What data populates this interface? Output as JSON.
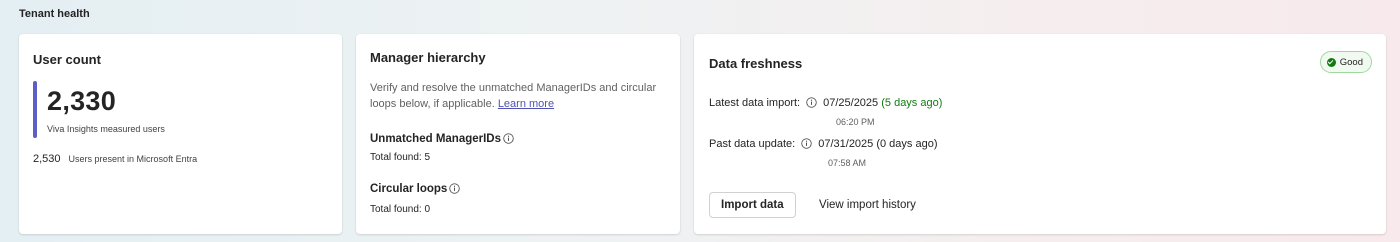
{
  "page": {
    "title": "Tenant health"
  },
  "user_count": {
    "title": "User count",
    "measured_value": "2,330",
    "measured_label": "Viva Insights measured users",
    "entra_value": "2,530",
    "entra_label": "Users present in Microsoft Entra",
    "accent_color": "#5b5fc7"
  },
  "manager_hierarchy": {
    "title": "Manager hierarchy",
    "description": "Verify and resolve the unmatched ManagerIDs and circular loops below, if applicable.",
    "learn_more": "Learn more",
    "unmatched": {
      "title": "Unmatched ManagerIDs",
      "count": "Total found: 5",
      "icon": "info-icon"
    },
    "circular": {
      "title": "Circular loops",
      "count": "Total found: 0",
      "icon": "info-icon"
    }
  },
  "data_freshness": {
    "title": "Data freshness",
    "status_badge": {
      "label": "Good",
      "color": "#107c10",
      "icon": "check-circle-icon"
    },
    "latest_import": {
      "label": "Latest data import:",
      "date": "07/25/2025",
      "ago": "(5 days ago)",
      "time": "06:20 PM",
      "ago_color": "#107c10"
    },
    "past_update": {
      "label": "Past data update:",
      "date": "07/31/2025 (0 days ago)",
      "time": "07:58 AM"
    },
    "import_button": "Import data",
    "history_button": "View import history"
  }
}
